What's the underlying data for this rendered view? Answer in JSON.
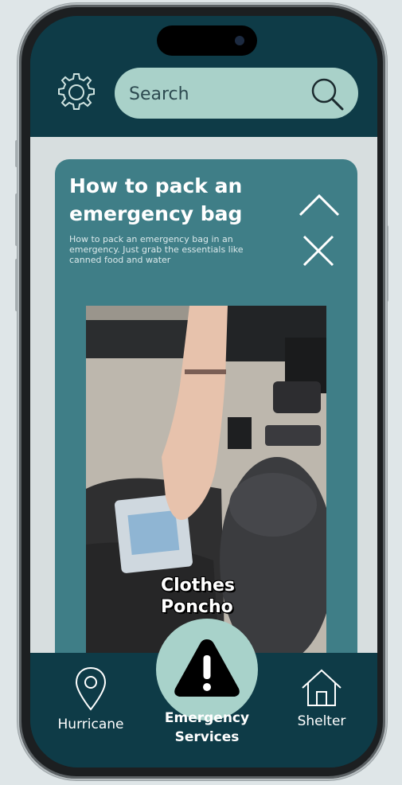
{
  "header": {
    "search": {
      "placeholder": "Search",
      "value": ""
    }
  },
  "card": {
    "title": "How to pack an emergency bag",
    "description": "How to pack an emergency bag in an emergency. Just grab the essentials like canned food and water",
    "video_caption_line1": "Clothes",
    "video_caption_line2": "Poncho"
  },
  "nav": {
    "left_label": "Hurricane",
    "center_label_line1": "Emergency",
    "center_label_line2": "Services",
    "right_label": "Shelter"
  },
  "icons": {
    "settings": "gear-icon",
    "search": "search-icon",
    "collapse": "chevron-up-icon",
    "close": "close-icon",
    "hurricane": "map-pin-icon",
    "emergency": "warning-triangle-icon",
    "shelter": "home-icon"
  },
  "colors": {
    "header_bg": "#0e3b47",
    "accent_mint": "#a9d1c9",
    "card_bg": "#3f7e87",
    "content_bg": "#d7dedf"
  }
}
